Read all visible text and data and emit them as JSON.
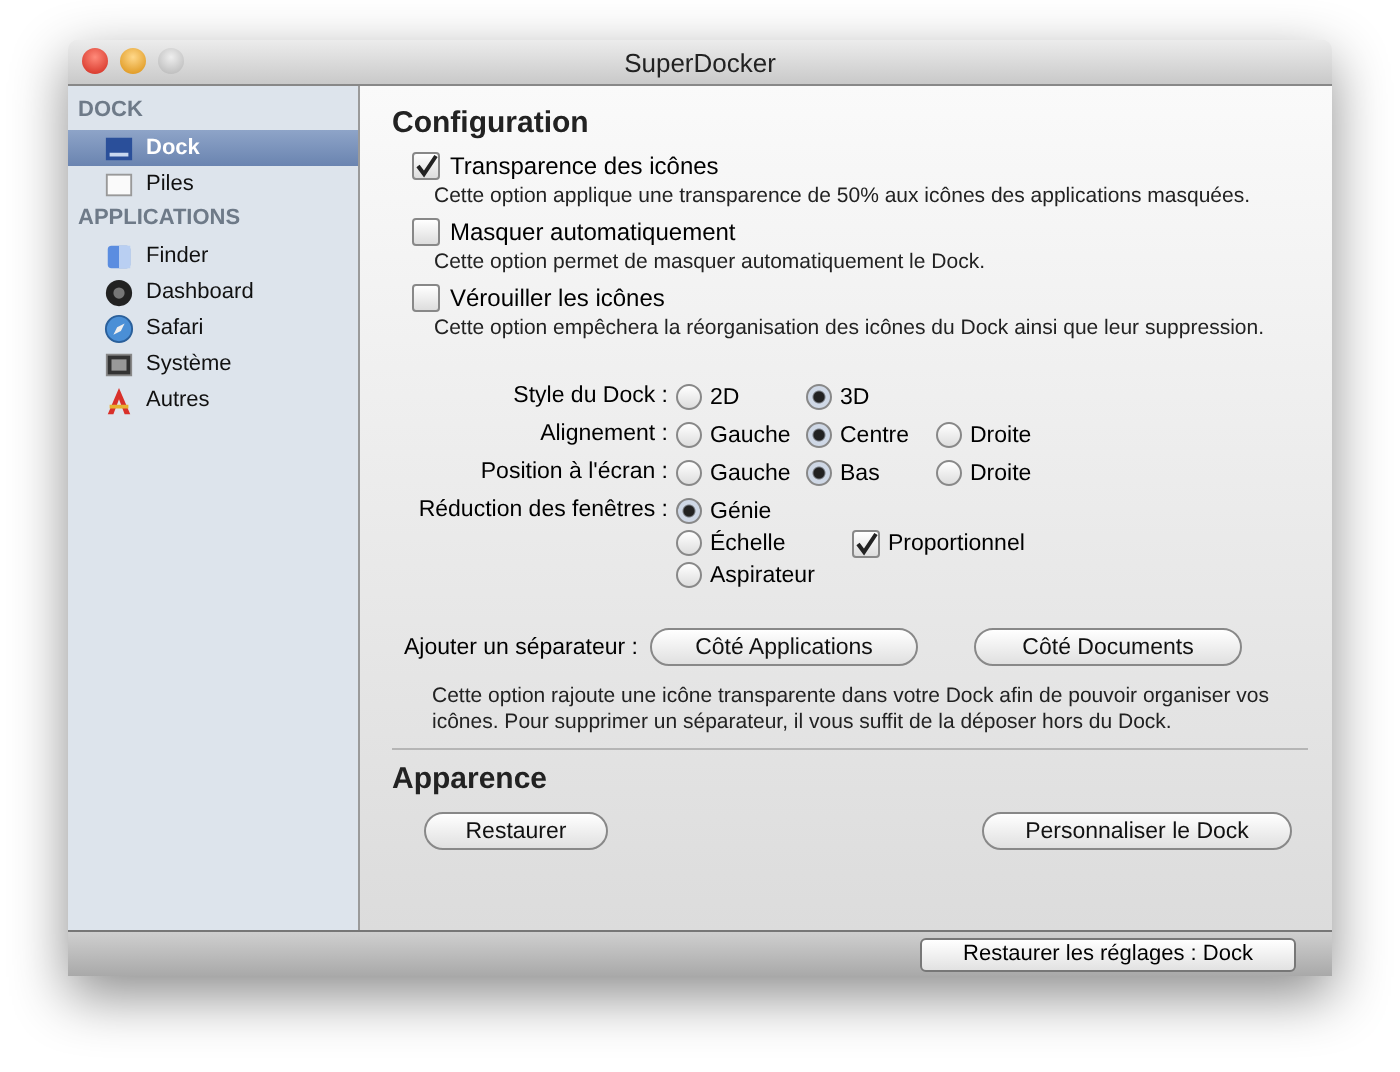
{
  "window": {
    "title": "SuperDocker"
  },
  "sidebar": {
    "sections": [
      {
        "heading": "DOCK",
        "items": [
          {
            "label": "Dock",
            "kind": "dock",
            "selected": true
          },
          {
            "label": "Piles",
            "kind": "stack",
            "selected": false
          }
        ]
      },
      {
        "heading": "APPLICATIONS",
        "items": [
          {
            "label": "Finder",
            "kind": "finder",
            "selected": false
          },
          {
            "label": "Dashboard",
            "kind": "dashboard",
            "selected": false
          },
          {
            "label": "Safari",
            "kind": "safari",
            "selected": false
          },
          {
            "label": "Système",
            "kind": "system",
            "selected": false
          },
          {
            "label": "Autres",
            "kind": "other",
            "selected": false
          }
        ]
      }
    ]
  },
  "configuration": {
    "heading": "Configuration",
    "checkboxes": [
      {
        "label": "Transparence des icônes",
        "checked": true,
        "description": "Cette option applique une transparence de 50% aux icônes des applications masquées."
      },
      {
        "label": "Masquer automatiquement",
        "checked": false,
        "description": "Cette option permet de masquer automatiquement le Dock."
      },
      {
        "label": "Vérouiller les icônes",
        "checked": false,
        "description": "Cette option empêchera la réorganisation des icônes du Dock ainsi que leur suppression."
      }
    ],
    "options": [
      {
        "label": "Style du Dock :",
        "kind": "row",
        "choices": [
          {
            "label": "2D",
            "selected": false
          },
          {
            "label": "3D",
            "selected": true
          }
        ]
      },
      {
        "label": "Alignement  :",
        "kind": "row",
        "choices": [
          {
            "label": "Gauche",
            "selected": false
          },
          {
            "label": "Centre",
            "selected": true
          },
          {
            "label": "Droite",
            "selected": false
          }
        ]
      },
      {
        "label": "Position à l'écran :",
        "kind": "row",
        "choices": [
          {
            "label": "Gauche",
            "selected": false
          },
          {
            "label": "Bas",
            "selected": true
          },
          {
            "label": "Droite",
            "selected": false
          }
        ]
      },
      {
        "label": "Réduction des fenêtres :",
        "kind": "stack",
        "choices": [
          {
            "label": "Génie",
            "selected": true
          },
          {
            "label": "Échelle",
            "selected": false
          },
          {
            "label": "Aspirateur",
            "selected": false
          }
        ],
        "checkbox": {
          "label": "Proportionnel",
          "checked": true
        }
      }
    ],
    "separator": {
      "label": "Ajouter un séparateur :",
      "buttons": [
        "Côté Applications",
        "Côté Documents"
      ],
      "description": "Cette option rajoute une icône transparente dans votre Dock afin de pouvoir organiser vos icônes. Pour supprimer un séparateur, il vous suffit de la déposer hors du Dock."
    }
  },
  "appearance": {
    "heading": "Apparence",
    "buttons": [
      "Restaurer",
      "Personnaliser le Dock"
    ]
  },
  "footer": {
    "button": "Restaurer les réglages : Dock"
  }
}
